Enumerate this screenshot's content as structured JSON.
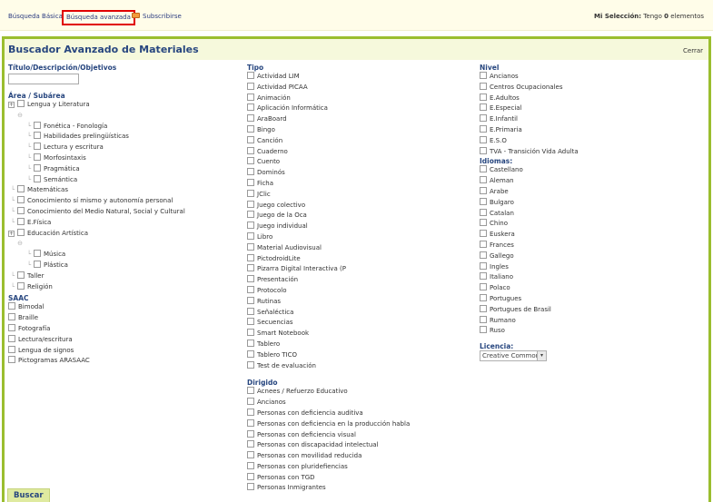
{
  "topbar": {
    "basic_search": "Búsqueda Básica",
    "advanced_search": "Búsqueda avanzada",
    "subscribe": "Subscribirse",
    "selection_label": "Mi Selección:",
    "selection_pre": "Tengo",
    "selection_count": "0",
    "selection_post": "elementos"
  },
  "panel": {
    "title": "Buscador Avanzado de Materiales",
    "close": "Cerrar",
    "search_button": "Buscar"
  },
  "col1": {
    "title_field_label": "Título/Descripción/Objetivos",
    "title_field_value": "",
    "area_label": "Área / Subárea",
    "areas": {
      "lengua": "Lengua y Literatura",
      "lengua_sub": [
        "Fonética - Fonología",
        "Habilidades prelingüísticas",
        "Lectura y escritura",
        "Morfosintaxis",
        "Pragmática",
        "Semántica"
      ],
      "others": [
        "Matemáticas",
        "Conocimiento sí mismo y autonomía personal",
        "Conocimiento del Medio Natural, Social y Cultural",
        "E.Física"
      ],
      "artistica": "Educación Artística",
      "artistica_sub": [
        "Música",
        "Plástica"
      ],
      "tail": [
        "Taller",
        "Religión"
      ]
    },
    "saac_label": "SAAC",
    "saac": [
      "Bimodal",
      "Braille",
      "Fotografía",
      "Lectura/escritura",
      "Lengua de signos",
      "Pictogramas ARASAAC"
    ]
  },
  "col2": {
    "tipo_label": "Tipo",
    "tipo": [
      "Actividad LIM",
      "Actividad PICAA",
      "Animación",
      "Aplicación Informática",
      "AraBoard",
      "Bingo",
      "Canción",
      "Cuaderno",
      "Cuento",
      "Dominós",
      "Ficha",
      "JClic",
      "Juego colectivo",
      "Juego de la Oca",
      "Juego individual",
      "Libro",
      "Material Audiovisual",
      "PictodroidLite",
      "Pizarra Digital Interactiva (P",
      "Presentación",
      "Protocolo",
      "Rutinas",
      "Señaléctica",
      "Secuencias",
      "Smart Notebook",
      "Tablero",
      "Tablero TICO",
      "Test de evaluación"
    ],
    "dirigido_label": "Dirigido",
    "dirigido": [
      "Acnees / Refuerzo Educativo",
      "Ancianos",
      "Personas con deficiencia auditiva",
      "Personas con deficiencia en la producción habla",
      "Personas con deficiencia visual",
      "Personas con discapacidad intelectual",
      "Personas con movilidad reducida",
      "Personas con pluridefiencias",
      "Personas con TGD",
      "Personas Inmigrantes"
    ]
  },
  "col3": {
    "nivel_label": "Nivel",
    "nivel": [
      "Ancianos",
      "Centros Ocupacionales",
      "E.Adultos",
      "E.Especial",
      "E.Infantil",
      "E.Primaria",
      "E.S.O",
      "TVA - Transición Vida Adulta"
    ],
    "idiomas_label": "Idiomas:",
    "idiomas": [
      "Castellano",
      "Aleman",
      "Arabe",
      "Bulgaro",
      "Catalan",
      "Chino",
      "Euskera",
      "Frances",
      "Gallego",
      "Ingles",
      "Italiano",
      "Polaco",
      "Portugues",
      "Portugues de Brasil",
      "Rumano",
      "Ruso"
    ],
    "licencia_label": "Licencia:",
    "licencia_value": "Creative Commor"
  }
}
